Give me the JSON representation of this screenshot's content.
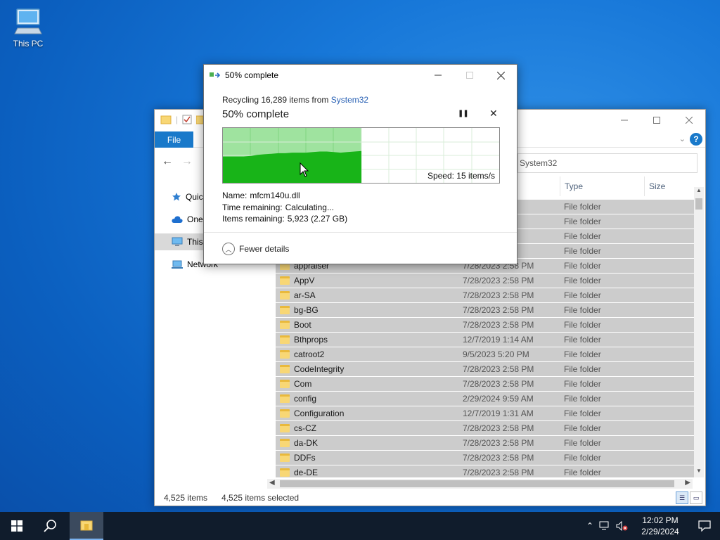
{
  "desktop": {
    "this_pc_label": "This PC"
  },
  "explorer": {
    "file_tab": "File",
    "address_text": "System32",
    "help": "?",
    "sidebar": [
      {
        "label": "Quic",
        "icon": "star-icon"
      },
      {
        "label": "OneI",
        "icon": "cloud-icon"
      },
      {
        "label": "This",
        "icon": "monitor-icon"
      },
      {
        "label": "Network",
        "icon": "network-icon"
      }
    ],
    "columns": {
      "type": "Type",
      "size": "Size"
    },
    "rows": [
      {
        "name": "",
        "date": "AM",
        "type": "File folder"
      },
      {
        "name": "",
        "date": "PM",
        "type": "File folder"
      },
      {
        "name": "",
        "date": "PM",
        "type": "File folder"
      },
      {
        "name": "",
        "date": "AM",
        "type": "File folder"
      },
      {
        "name": "appraiser",
        "date": "7/28/2023 2:58 PM",
        "type": "File folder"
      },
      {
        "name": "AppV",
        "date": "7/28/2023 2:58 PM",
        "type": "File folder"
      },
      {
        "name": "ar-SA",
        "date": "7/28/2023 2:58 PM",
        "type": "File folder"
      },
      {
        "name": "bg-BG",
        "date": "7/28/2023 2:58 PM",
        "type": "File folder"
      },
      {
        "name": "Boot",
        "date": "7/28/2023 2:58 PM",
        "type": "File folder"
      },
      {
        "name": "Bthprops",
        "date": "12/7/2019 1:14 AM",
        "type": "File folder"
      },
      {
        "name": "catroot2",
        "date": "9/5/2023 5:20 PM",
        "type": "File folder"
      },
      {
        "name": "CodeIntegrity",
        "date": "7/28/2023 2:58 PM",
        "type": "File folder"
      },
      {
        "name": "Com",
        "date": "7/28/2023 2:58 PM",
        "type": "File folder"
      },
      {
        "name": "config",
        "date": "2/29/2024 9:59 AM",
        "type": "File folder"
      },
      {
        "name": "Configuration",
        "date": "12/7/2019 1:31 AM",
        "type": "File folder"
      },
      {
        "name": "cs-CZ",
        "date": "7/28/2023 2:58 PM",
        "type": "File folder"
      },
      {
        "name": "da-DK",
        "date": "7/28/2023 2:58 PM",
        "type": "File folder"
      },
      {
        "name": "DDFs",
        "date": "7/28/2023 2:58 PM",
        "type": "File folder"
      },
      {
        "name": "de-DE",
        "date": "7/28/2023 2:58 PM",
        "type": "File folder"
      }
    ],
    "status": {
      "count": "4,525 items",
      "selected": "4,525 items selected"
    }
  },
  "dialog": {
    "title": "50% complete",
    "subtitle_prefix": "Recycling 16,289 items from",
    "subtitle_link": "System32",
    "heading": "50% complete",
    "progress_percent": 50,
    "speed": "Speed: 15 items/s",
    "name_label": "Name:",
    "name_value": "mfcm140u.dll",
    "time_label": "Time remaining:",
    "time_value": "Calculating...",
    "items_label": "Items remaining:",
    "items_value": "5,923 (2.27 GB)",
    "fewer_details": "Fewer details",
    "colors": {
      "graph_fill_dark": "#18b418",
      "graph_fill_light": "#9fe39f"
    }
  },
  "taskbar": {
    "time": "12:02 PM",
    "date": "2/29/2024"
  }
}
